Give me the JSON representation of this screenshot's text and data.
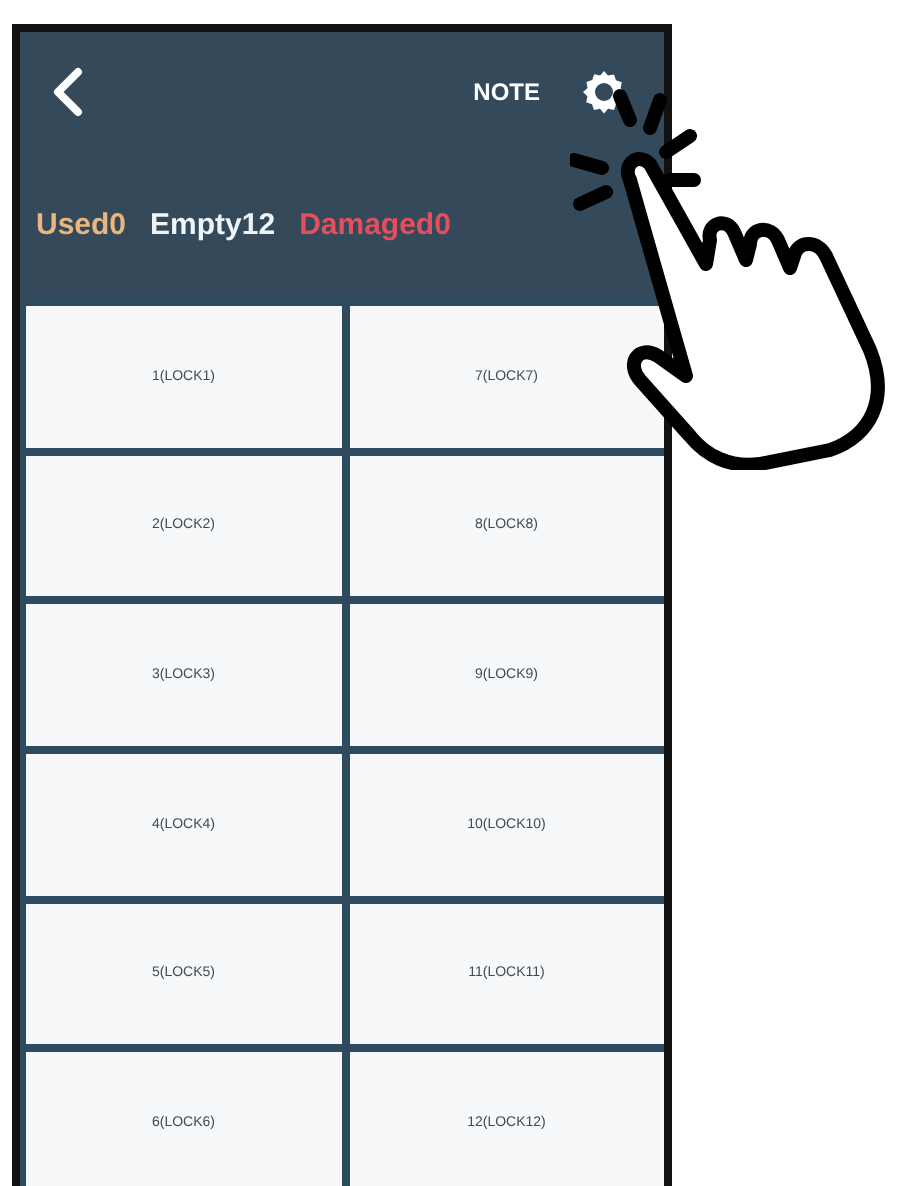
{
  "header": {
    "title": "NOTE"
  },
  "counts": [
    {
      "kind": "used",
      "text": "Used0"
    },
    {
      "kind": "empty",
      "text": "Empty12"
    },
    {
      "kind": "damaged",
      "text": "Damaged0"
    }
  ],
  "lockers": [
    {
      "label": "1(LOCK1)"
    },
    {
      "label": "2(LOCK2)"
    },
    {
      "label": "3(LOCK3)"
    },
    {
      "label": "4(LOCK4)"
    },
    {
      "label": "5(LOCK5)"
    },
    {
      "label": "6(LOCK6)"
    },
    {
      "label": "7(LOCK7)"
    },
    {
      "label": "8(LOCK8)"
    },
    {
      "label": "9(LOCK9)"
    },
    {
      "label": "10(LOCK10)"
    },
    {
      "label": "11(LOCK11)"
    },
    {
      "label": "12(LOCK12)"
    }
  ]
}
